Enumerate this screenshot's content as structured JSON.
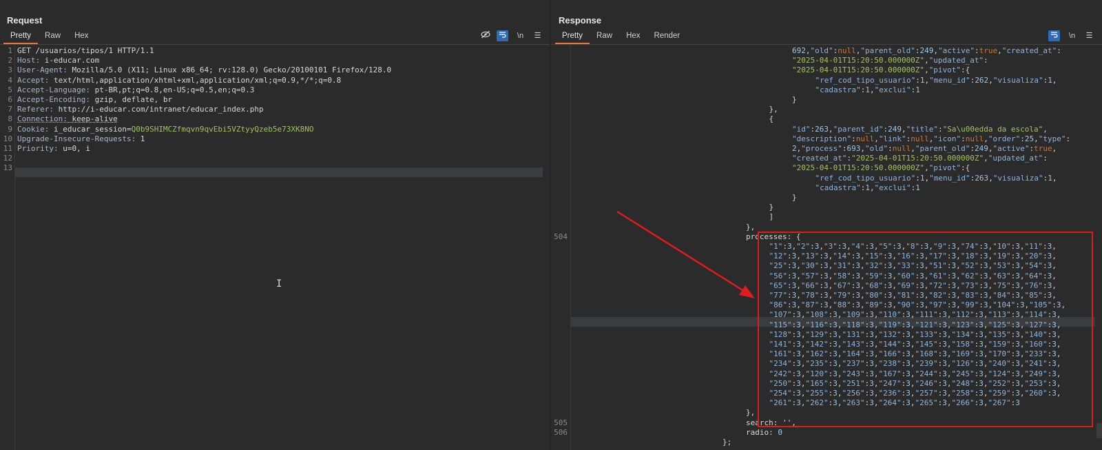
{
  "request": {
    "title": "Request",
    "tabs": [
      "Pretty",
      "Raw",
      "Hex"
    ],
    "lines": [
      {
        "n": "1",
        "text": "GET /usuarios/tipos/1 HTTP/1.1"
      },
      {
        "n": "2",
        "key": "Host:",
        "val": " i-educar.com"
      },
      {
        "n": "3",
        "key": "User-Agent:",
        "val": " Mozilla/5.0 (X11; Linux x86_64; rv:128.0) Gecko/20100101 Firefox/128.0"
      },
      {
        "n": "4",
        "key": "Accept:",
        "val": " text/html,application/xhtml+xml,application/xml;q=0.9,*/*;q=0.8"
      },
      {
        "n": "5",
        "key": "Accept-Language:",
        "val": " pt-BR,pt;q=0.8,en-US;q=0.5,en;q=0.3"
      },
      {
        "n": "6",
        "key": "Accept-Encoding:",
        "val": " gzip, deflate, br"
      },
      {
        "n": "7",
        "key": "Referer:",
        "val": " http://i-educar.com/intranet/educar_index.php"
      },
      {
        "n": "8",
        "key": "Connection:",
        "val": " keep-alive"
      },
      {
        "n": "9",
        "key": "Cookie:",
        "val": " i_educar_session=",
        "cookie": "Q0b9SHIMCZfmqvn9qvEbi5VZtyyQzeb5e73XK8NO"
      },
      {
        "n": "10",
        "key": "Upgrade-Insecure-Requests:",
        "val": " 1"
      },
      {
        "n": "11",
        "key": "Priority:",
        "val": " u=0, i"
      },
      {
        "n": "12",
        "text": ""
      },
      {
        "n": "13",
        "text": ""
      }
    ]
  },
  "response": {
    "title": "Response",
    "tabs": [
      "Pretty",
      "Raw",
      "Hex",
      "Render"
    ],
    "line_numbers": [
      {
        "row": 19,
        "n": "504"
      },
      {
        "row": 38,
        "n": "505"
      },
      {
        "row": 39,
        "n": "506"
      }
    ],
    "lines": [
      {
        "indent": 3,
        "text": "692,\"old\":null,\"parent_old\":249,\"active\":true,\"created_at\":"
      },
      {
        "indent": 3,
        "text": "\"2025-04-01T15:20:50.000000Z\",\"updated_at\":"
      },
      {
        "indent": 3,
        "text": "\"2025-04-01T15:20:50.000000Z\",\"pivot\":{"
      },
      {
        "indent": 4,
        "text": "\"ref_cod_tipo_usuario\":1,\"menu_id\":262,\"visualiza\":1,"
      },
      {
        "indent": 4,
        "text": "\"cadastra\":1,\"exclui\":1"
      },
      {
        "indent": 3,
        "text": "}"
      },
      {
        "indent": 2,
        "text": "},"
      },
      {
        "indent": 2,
        "text": "{"
      },
      {
        "indent": 3,
        "text": "\"id\":263,\"parent_id\":249,\"title\":\"Sa\\u00edda da escola\","
      },
      {
        "indent": 3,
        "text": "\"description\":null,\"link\":null,\"icon\":null,\"order\":25,\"type\":"
      },
      {
        "indent": 3,
        "text": "2,\"process\":693,\"old\":null,\"parent_old\":249,\"active\":true,"
      },
      {
        "indent": 3,
        "text": "\"created_at\":\"2025-04-01T15:20:50.000000Z\",\"updated_at\":"
      },
      {
        "indent": 3,
        "text": "\"2025-04-01T15:20:50.000000Z\",\"pivot\":{"
      },
      {
        "indent": 4,
        "text": "\"ref_cod_tipo_usuario\":1,\"menu_id\":263,\"visualiza\":1,"
      },
      {
        "indent": 4,
        "text": "\"cadastra\":1,\"exclui\":1"
      },
      {
        "indent": 3,
        "text": "}"
      },
      {
        "indent": 2,
        "text": "}"
      },
      {
        "indent": 2,
        "text": "]"
      },
      {
        "indent": 1,
        "text": "},"
      },
      {
        "indent": 1,
        "text": "processes: {"
      },
      {
        "indent": 2,
        "text": "\"1\":3,\"2\":3,\"3\":3,\"4\":3,\"5\":3,\"8\":3,\"9\":3,\"74\":3,\"10\":3,\"11\":3,"
      },
      {
        "indent": 2,
        "text": "\"12\":3,\"13\":3,\"14\":3,\"15\":3,\"16\":3,\"17\":3,\"18\":3,\"19\":3,\"20\":3,"
      },
      {
        "indent": 2,
        "text": "\"25\":3,\"30\":3,\"31\":3,\"32\":3,\"33\":3,\"51\":3,\"52\":3,\"53\":3,\"54\":3,"
      },
      {
        "indent": 2,
        "text": "\"56\":3,\"57\":3,\"58\":3,\"59\":3,\"60\":3,\"61\":3,\"62\":3,\"63\":3,\"64\":3,"
      },
      {
        "indent": 2,
        "text": "\"65\":3,\"66\":3,\"67\":3,\"68\":3,\"69\":3,\"72\":3,\"73\":3,\"75\":3,\"76\":3,"
      },
      {
        "indent": 2,
        "text": "\"77\":3,\"78\":3,\"79\":3,\"80\":3,\"81\":3,\"82\":3,\"83\":3,\"84\":3,\"85\":3,"
      },
      {
        "indent": 2,
        "text": "\"86\":3,\"87\":3,\"88\":3,\"89\":3,\"90\":3,\"97\":3,\"99\":3,\"104\":3,\"105\":3,"
      },
      {
        "indent": 2,
        "text": "\"107\":3,\"108\":3,\"109\":3,\"110\":3,\"111\":3,\"112\":3,\"113\":3,\"114\":3,"
      },
      {
        "indent": 2,
        "text": "\"115\":3,\"116\":3,\"118\":3,\"119\":3,\"121\":3,\"123\":3,\"125\":3,\"127\":3,"
      },
      {
        "indent": 2,
        "text": "\"128\":3,\"129\":3,\"131\":3,\"132\":3,\"133\":3,\"134\":3,\"135\":3,\"140\":3,"
      },
      {
        "indent": 2,
        "text": "\"141\":3,\"142\":3,\"143\":3,\"144\":3,\"145\":3,\"158\":3,\"159\":3,\"160\":3,"
      },
      {
        "indent": 2,
        "text": "\"161\":3,\"162\":3,\"164\":3,\"166\":3,\"168\":3,\"169\":3,\"170\":3,\"233\":3,"
      },
      {
        "indent": 2,
        "text": "\"234\":3,\"235\":3,\"237\":3,\"238\":3,\"239\":3,\"126\":3,\"240\":3,\"241\":3,"
      },
      {
        "indent": 2,
        "text": "\"242\":3,\"120\":3,\"243\":3,\"167\":3,\"244\":3,\"245\":3,\"124\":3,\"249\":3,"
      },
      {
        "indent": 2,
        "text": "\"250\":3,\"165\":3,\"251\":3,\"247\":3,\"246\":3,\"248\":3,\"252\":3,\"253\":3,"
      },
      {
        "indent": 2,
        "text": "\"254\":3,\"255\":3,\"256\":3,\"236\":3,\"257\":3,\"258\":3,\"259\":3,\"260\":3,"
      },
      {
        "indent": 2,
        "text": "\"261\":3,\"262\":3,\"263\":3,\"264\":3,\"265\":3,\"266\":3,\"267\":3"
      },
      {
        "indent": 1,
        "text": "},"
      },
      {
        "indent": 1,
        "text": "search: '',"
      },
      {
        "indent": 1,
        "text": "radio: 0"
      },
      {
        "indent": 0,
        "text": "};"
      }
    ]
  },
  "toolbar": {
    "newline_label": "\\n",
    "menu_icon": "hamburger-icon",
    "eye_icon": "eye-off-icon",
    "wrap_icon": "wrap-icon"
  },
  "colors": {
    "background": "#2b2b2b",
    "accent": "#e8783a",
    "highlight": "#e01c1c",
    "toggle_blue": "#2d6cb5"
  }
}
